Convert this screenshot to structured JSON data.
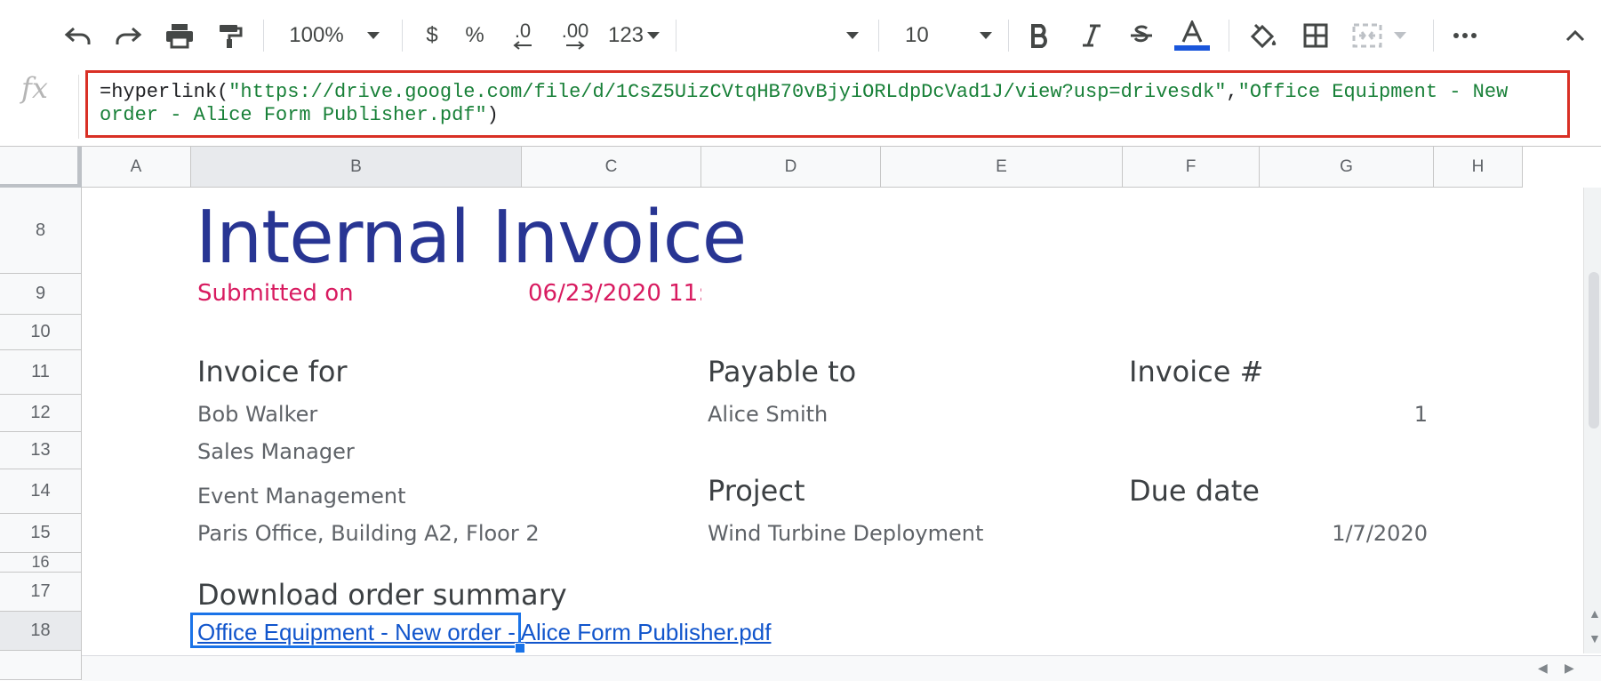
{
  "toolbar": {
    "zoom": "100%",
    "currency_label": "$",
    "percent_label": "%",
    "decrease_decimal_label": ".0",
    "increase_decimal_label": ".00",
    "number_format_label": "123",
    "font_family": "",
    "font_size": "10",
    "text_color_bar": "#1a56db"
  },
  "formula_bar": {
    "fx_label": "fx",
    "prefix": "=hyperlink(",
    "url_string": "\"https://drive.google.com/file/d/1CsZ5UizCVtqHB70vBjyiORLdpDcVad1J/view?usp=drivesdk\"",
    "comma": ",",
    "label_string": "\"Office Equipment - New order - Alice Form Publisher.pdf\"",
    "suffix": ")"
  },
  "columns": [
    "A",
    "B",
    "C",
    "D",
    "E",
    "F",
    "G",
    "H"
  ],
  "rows": [
    "8",
    "9",
    "10",
    "11",
    "12",
    "13",
    "14",
    "15",
    "16",
    "17",
    "18"
  ],
  "sheet": {
    "title": "Internal Invoice",
    "submitted_label": "Submitted on",
    "submitted_value": "06/23/2020 11:",
    "invoice_for_label": "Invoice for",
    "invoice_for_name": "Bob Walker",
    "invoice_for_role": "Sales Manager",
    "invoice_for_dept": "Event Management",
    "invoice_for_address": "Paris Office, Building A2, Floor 2",
    "payable_to_label": "Payable to",
    "payable_to_name": "Alice Smith",
    "project_label": "Project",
    "project_value": "Wind Turbine Deployment",
    "invoice_num_label": "Invoice #",
    "invoice_num_value": "1",
    "due_date_label": "Due date",
    "due_date_value": "1/7/2020",
    "download_label": "Download order summary",
    "download_link": "Office Equipment - New order - Alice Form Publisher.pdf"
  }
}
